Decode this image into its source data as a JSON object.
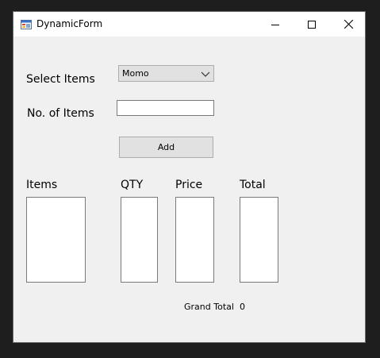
{
  "window": {
    "title": "DynamicForm"
  },
  "form": {
    "select_items_label": "Select Items",
    "select_items_value": "Momo",
    "num_items_label": "No. of Items",
    "num_items_value": "",
    "add_button_label": "Add"
  },
  "columns": {
    "items": "Items",
    "qty": "QTY",
    "price": "Price",
    "total": "Total"
  },
  "summary": {
    "grand_total_label": "Grand Total",
    "grand_total_value": "0"
  },
  "icons": {
    "app": "app-icon",
    "minimize": "minimize-icon",
    "maximize": "maximize-icon",
    "close": "close-icon",
    "dropdown": "chevron-down-icon"
  }
}
